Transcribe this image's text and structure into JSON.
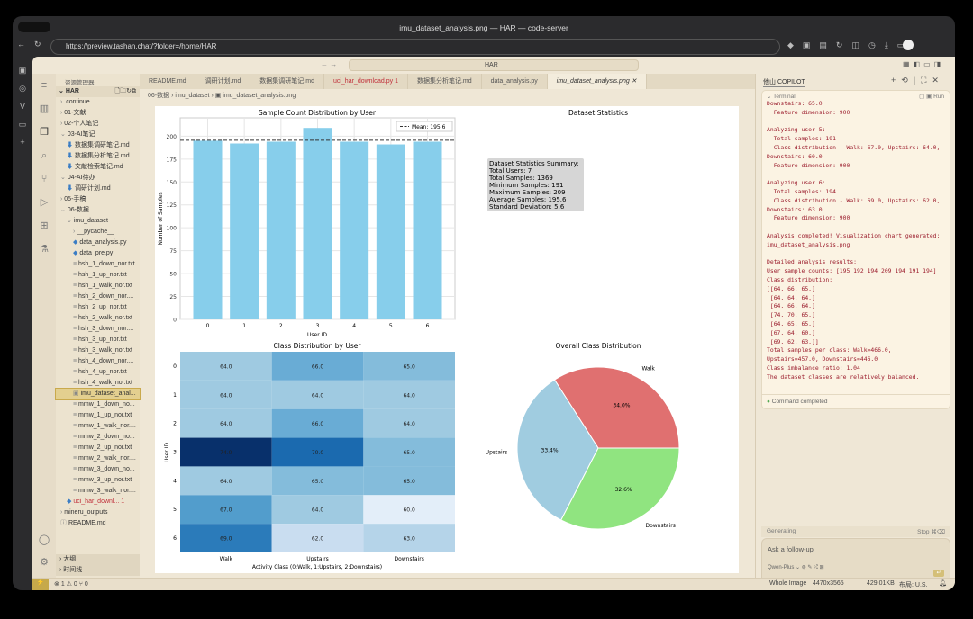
{
  "browser": {
    "title": "imu_dataset_analysis.png — HAR — code-server",
    "url": "https://preview.tashan.chat/?folder=/home/HAR"
  },
  "vscode": {
    "search": "HAR",
    "explorer_title": "资源管理器",
    "root": "HAR",
    "tree": [
      {
        "l": ".continue",
        "d": 1,
        "i": "›"
      },
      {
        "l": "01-文献",
        "d": 1,
        "i": "›"
      },
      {
        "l": "02-个人笔记",
        "d": 1,
        "i": "›"
      },
      {
        "l": "03-AI笔记",
        "d": 1,
        "i": "⌄"
      },
      {
        "l": "数据集调研笔记.md",
        "d": 2,
        "i": "⬇"
      },
      {
        "l": "数据集分析笔记.md",
        "d": 2,
        "i": "⬇"
      },
      {
        "l": "文献检索笔记.md",
        "d": 2,
        "i": "⬇"
      },
      {
        "l": "04-AI待办",
        "d": 1,
        "i": "⌄"
      },
      {
        "l": "调研计划.md",
        "d": 2,
        "i": "⬇"
      },
      {
        "l": "05-手稿",
        "d": 1,
        "i": "›"
      },
      {
        "l": "06-数据",
        "d": 1,
        "i": "⌄"
      },
      {
        "l": "imu_dataset",
        "d": 2,
        "i": "⌄"
      },
      {
        "l": "__pycache__",
        "d": 3,
        "i": "›"
      },
      {
        "l": "data_analysis.py",
        "d": 3,
        "i": "◆"
      },
      {
        "l": "data_pre.py",
        "d": 3,
        "i": "◆"
      },
      {
        "l": "hsh_1_down_nor.txt",
        "d": 3,
        "i": "≡"
      },
      {
        "l": "hsh_1_up_nor.txt",
        "d": 3,
        "i": "≡"
      },
      {
        "l": "hsh_1_walk_nor.txt",
        "d": 3,
        "i": "≡"
      },
      {
        "l": "hsh_2_down_nor....",
        "d": 3,
        "i": "≡"
      },
      {
        "l": "hsh_2_up_nor.txt",
        "d": 3,
        "i": "≡"
      },
      {
        "l": "hsh_2_walk_nor.txt",
        "d": 3,
        "i": "≡"
      },
      {
        "l": "hsh_3_down_nor....",
        "d": 3,
        "i": "≡"
      },
      {
        "l": "hsh_3_up_nor.txt",
        "d": 3,
        "i": "≡"
      },
      {
        "l": "hsh_3_walk_nor.txt",
        "d": 3,
        "i": "≡"
      },
      {
        "l": "hsh_4_down_nor....",
        "d": 3,
        "i": "≡"
      },
      {
        "l": "hsh_4_up_nor.txt",
        "d": 3,
        "i": "≡"
      },
      {
        "l": "hsh_4_walk_nor.txt",
        "d": 3,
        "i": "≡"
      },
      {
        "l": "imu_dataset_anal...",
        "d": 3,
        "i": "▣",
        "sel": true
      },
      {
        "l": "mmw_1_down_no...",
        "d": 3,
        "i": "≡"
      },
      {
        "l": "mmw_1_up_nor.txt",
        "d": 3,
        "i": "≡"
      },
      {
        "l": "mmw_1_walk_nor....",
        "d": 3,
        "i": "≡"
      },
      {
        "l": "mmw_2_down_no...",
        "d": 3,
        "i": "≡"
      },
      {
        "l": "mmw_2_up_nor.txt",
        "d": 3,
        "i": "≡"
      },
      {
        "l": "mmw_2_walk_nor....",
        "d": 3,
        "i": "≡"
      },
      {
        "l": "mmw_3_down_no...",
        "d": 3,
        "i": "≡"
      },
      {
        "l": "mmw_3_up_nor.txt",
        "d": 3,
        "i": "≡"
      },
      {
        "l": "mmw_3_walk_nor....",
        "d": 3,
        "i": "≡"
      },
      {
        "l": "uci_har_downl...  1",
        "d": 2,
        "i": "◆",
        "err": true
      },
      {
        "l": "mineru_outputs",
        "d": 1,
        "i": "›"
      },
      {
        "l": "README.md",
        "d": 1,
        "i": "ⓘ"
      }
    ],
    "outline": "大纲",
    "timeline": "时间线",
    "tabs": [
      "README.md",
      "调研计划.md",
      "数据集调研笔记.md",
      "uci_har_download.py 1",
      "数据集分析笔记.md",
      "data_analysis.py",
      "imu_dataset_analysis.png"
    ],
    "breadcrumb": [
      "06-数据",
      "imu_dataset",
      "imu_dataset_analysis.png"
    ]
  },
  "copilot": {
    "title": "他山 COPILOT",
    "terminal_label": "Terminal",
    "run": "Run",
    "terminal": "Downstairs: 65.0\n  Feature dimension: 900\n\nAnalyzing user 5:\n  Total samples: 191\n  Class distribution - Walk: 67.0, Upstairs: 64.0,\nDownstairs: 60.0\n  Feature dimension: 900\n\nAnalyzing user 6:\n  Total samples: 194\n  Class distribution - Walk: 69.0, Upstairs: 62.0,\nDownstairs: 63.0\n  Feature dimension: 900\n\nAnalysis completed! Visualization chart generated:\nimu_dataset_analysis.png\n\nDetailed analysis results:\nUser sample counts: [195 192 194 209 194 191 194]\nClass distribution:\n[[64. 66. 65.]\n [64. 64. 64.]\n [64. 66. 64.]\n [74. 70. 65.]\n [64. 65. 65.]\n [67. 64. 60.]\n [69. 62. 63.]]\nTotal samples per class: Walk=466.0,\nUpstairs=457.0, Downstairs=446.0\nClass imbalance ratio: 1.04\nThe dataset classes are relatively balanced.",
    "completed": "Command completed",
    "generating": "Generating",
    "stop": "Stop ⌘⌫",
    "placeholder": "Ask a follow-up",
    "model": "Qwen-Plus ⌄"
  },
  "status": {
    "errors": "1",
    "warnings": "0",
    "ports": "0",
    "mode": "Whole Image",
    "dims": "4470x3565",
    "size": "429.01KB",
    "layout": "布局: U.S."
  },
  "chart_data": [
    {
      "type": "bar",
      "title": "Sample Count Distribution by User",
      "xlabel": "User ID",
      "ylabel": "Number of Samples",
      "categories": [
        "0",
        "1",
        "2",
        "3",
        "4",
        "5",
        "6"
      ],
      "values": [
        195,
        192,
        194,
        209,
        194,
        191,
        194
      ],
      "ylim": [
        0,
        220
      ],
      "yticks": [
        0,
        25,
        50,
        75,
        100,
        125,
        150,
        175,
        200
      ],
      "mean": 195.6,
      "legend": "Mean: 195.6",
      "color": "#87ceeb"
    },
    {
      "type": "table",
      "title": "Dataset Statistics",
      "lines": [
        "Dataset Statistics Summary:",
        "Total Users: 7",
        "Total Samples: 1369",
        "Minimum Samples: 191",
        "Maximum Samples: 209",
        "Average Samples: 195.6",
        "Standard Deviation: 5.6"
      ]
    },
    {
      "type": "heatmap",
      "title": "Class Distribution by User",
      "xlabel": "Activity Class (0:Walk, 1:Upstairs, 2:Downstairs)",
      "ylabel": "User ID",
      "x": [
        "Walk",
        "Upstairs",
        "Downstairs"
      ],
      "y": [
        "0",
        "1",
        "2",
        "3",
        "4",
        "5",
        "6"
      ],
      "values": [
        [
          64,
          66,
          65
        ],
        [
          64,
          64,
          64
        ],
        [
          64,
          66,
          64
        ],
        [
          74,
          70,
          65
        ],
        [
          64,
          65,
          65
        ],
        [
          67,
          64,
          60
        ],
        [
          69,
          62,
          63
        ]
      ]
    },
    {
      "type": "pie",
      "title": "Overall Class Distribution",
      "labels": [
        "Walk",
        "Upstairs",
        "Downstairs"
      ],
      "values": [
        466,
        457,
        446
      ],
      "pct": [
        "34.0%",
        "33.4%",
        "32.6%"
      ],
      "colors": [
        "#e07070",
        "#a0cce0",
        "#90e480"
      ]
    }
  ]
}
